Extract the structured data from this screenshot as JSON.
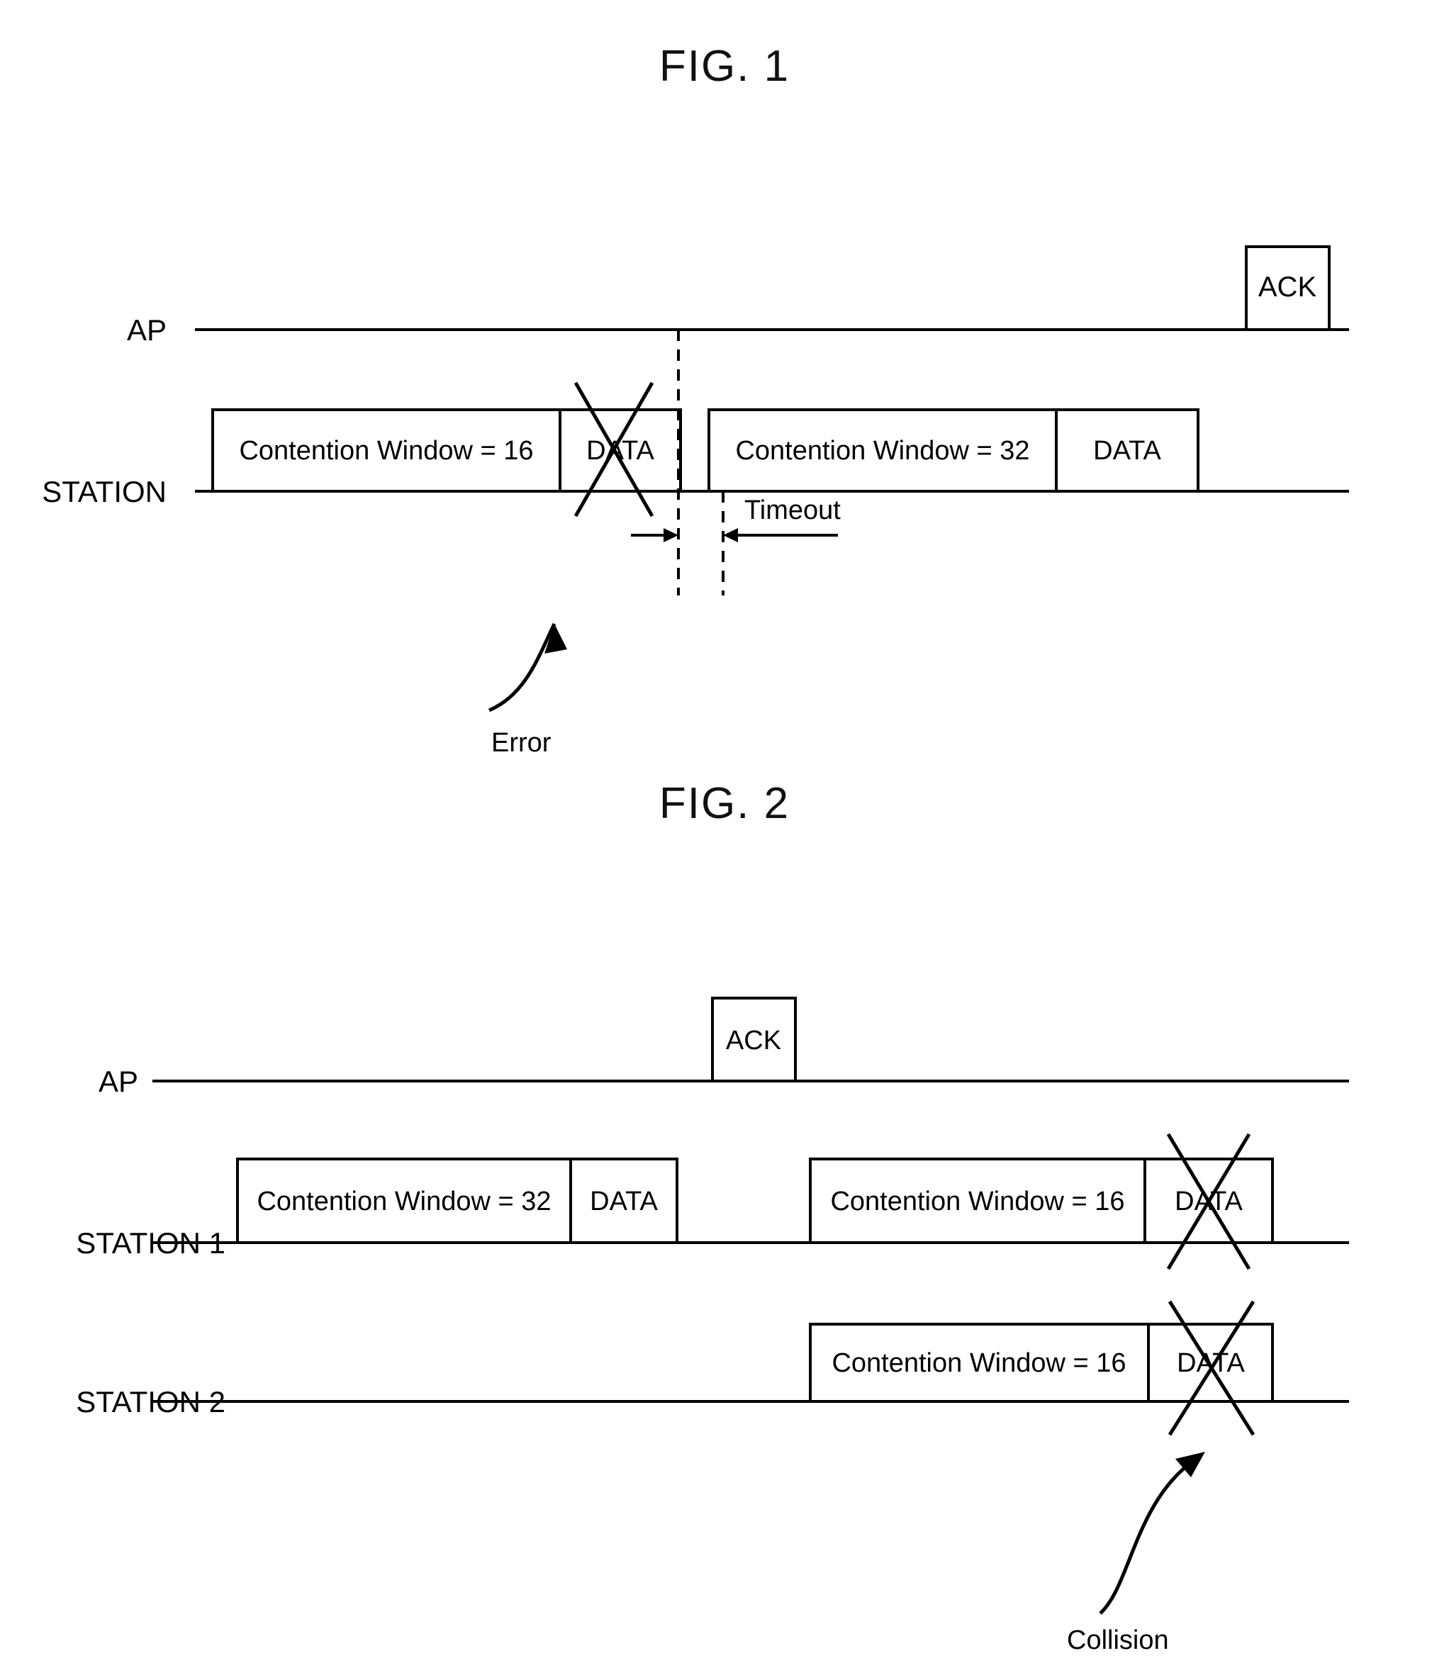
{
  "figures": [
    {
      "title": "FIG. 1",
      "lanes": [
        {
          "label": "AP"
        },
        {
          "label": "STATION"
        }
      ],
      "ap_frames": [
        {
          "label": "ACK"
        }
      ],
      "station_frames": [
        {
          "label": "Contention Window = 16"
        },
        {
          "label": "DATA",
          "error": true
        },
        {
          "label": "Contention Window = 32"
        },
        {
          "label": "DATA",
          "error": false
        }
      ],
      "annotations": [
        {
          "label": "Error"
        },
        {
          "label": "Timeout"
        }
      ]
    },
    {
      "title": "FIG. 2",
      "lanes": [
        {
          "label": "AP"
        },
        {
          "label": "STATION 1"
        },
        {
          "label": "STATION 2"
        }
      ],
      "ap_frames": [
        {
          "label": "ACK"
        }
      ],
      "station1_frames": [
        {
          "label": "Contention Window = 32"
        },
        {
          "label": "DATA",
          "error": false
        },
        {
          "label": "Contention Window = 16"
        },
        {
          "label": "DATA",
          "error": true
        }
      ],
      "station2_frames": [
        {
          "label": "Contention Window = 16"
        },
        {
          "label": "DATA",
          "error": true
        }
      ],
      "annotations": [
        {
          "label": "Collision"
        }
      ]
    }
  ],
  "colors": {
    "ink": "#000000",
    "paper": "#ffffff"
  }
}
